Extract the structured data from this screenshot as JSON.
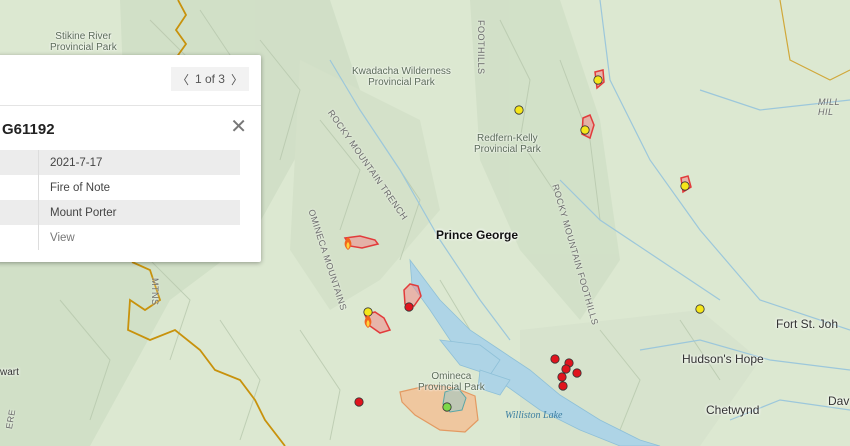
{
  "map": {
    "parks": [
      {
        "id": "stikine",
        "label": "Stikine River\nProvincial Park"
      },
      {
        "id": "kwadacha",
        "label": "Kwadacha Wilderness\nProvincial Park"
      },
      {
        "id": "redfern",
        "label": "Redfern-Kelly\nProvincial Park"
      },
      {
        "id": "omineca",
        "label": "Omineca\nProvincial Park"
      }
    ],
    "ranges": {
      "foothills_top": "FOOTHILLS",
      "trench": "ROCKY MOUNTAIN TRENCH",
      "omineca_mtns": "OMINECA MOUNTAINS",
      "rocky_foothills": "ROCKY MOUNTAIN FOOTHILLS",
      "mill_hi": "MILL\nHIL",
      "mtns_fragment": "MTNS",
      "bottom_fragment": "ERE"
    },
    "places": {
      "prince_george": "Prince George",
      "fort_st_john": "Fort St. Joh",
      "hudsons_hope": "Hudson's Hope",
      "chetwynd": "Chetwynd",
      "dav": "Dav",
      "wart": "wart"
    },
    "lake": "Williston Lake",
    "colors": {
      "fire_red": "#e0141e",
      "fire_yellow": "#f5e61a",
      "fire_green": "#7ed84a",
      "perimeter": "#e23b3b",
      "water": "#aed4e6",
      "boundary": "#c8920c"
    }
  },
  "popup": {
    "pager": "1 of 3",
    "title": "G61192",
    "rows": [
      {
        "value": "2021-7-17"
      },
      {
        "value": "Fire of Note"
      },
      {
        "value": "Mount Porter"
      },
      {
        "value": "View"
      }
    ]
  }
}
